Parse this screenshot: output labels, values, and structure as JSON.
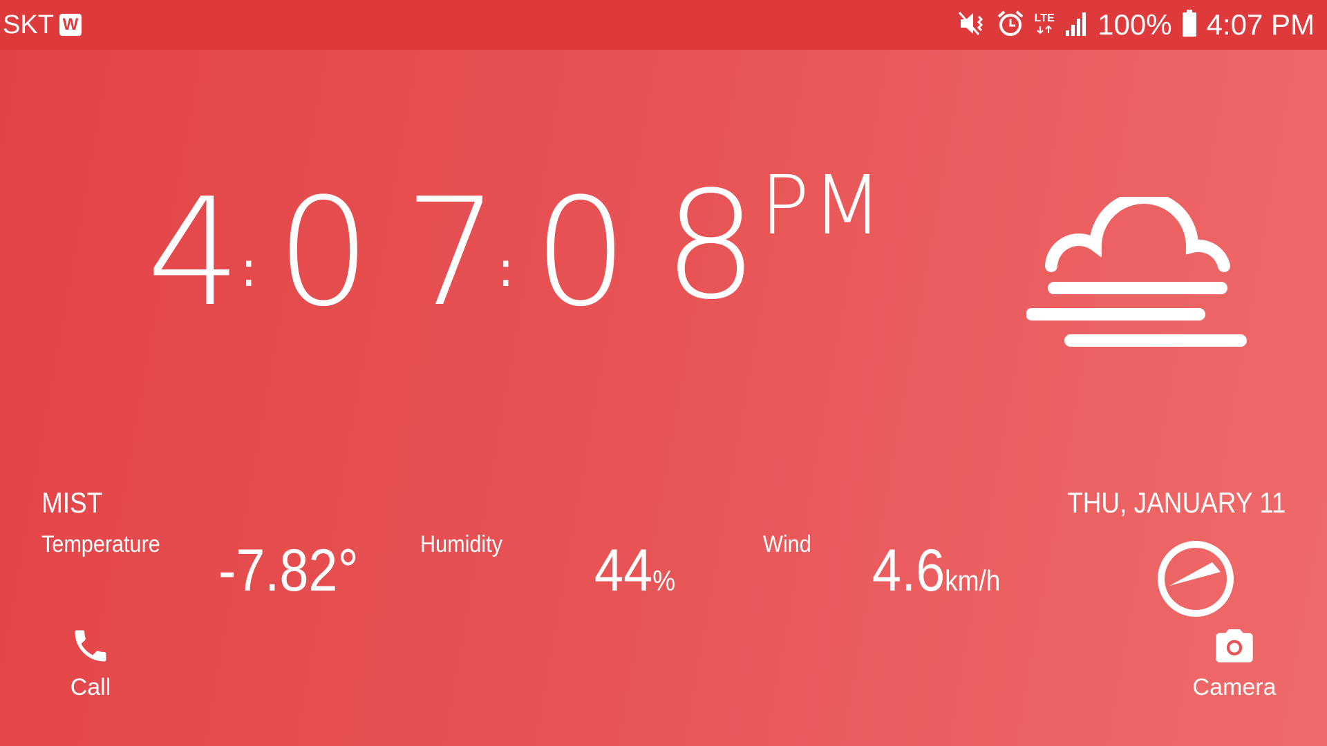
{
  "status_bar": {
    "carrier": "SKT",
    "badge": "W",
    "network": "LTE",
    "battery": "100%",
    "time": "4:07 PM",
    "icons": [
      "vibrate-mute-icon",
      "alarm-icon",
      "lte-icon",
      "signal-icon",
      "battery-icon"
    ]
  },
  "clock": {
    "h": "4",
    "m1": "0",
    "m2": "7",
    "s1": "0",
    "s2": "8",
    "colon": ":",
    "ampm": "PM"
  },
  "weather": {
    "condition": "MIST",
    "icon": "mist-icon",
    "temperature_label": "Temperature",
    "temperature_value": "-7.82°",
    "humidity_label": "Humidity",
    "humidity_value": "44",
    "humidity_unit": "%",
    "wind_label": "Wind",
    "wind_value": "4.6",
    "wind_unit": "km/h",
    "wind_direction_icon": "wind-compass-icon"
  },
  "date": "THU, JANUARY 11",
  "shortcuts": {
    "call_label": "Call",
    "camera_label": "Camera"
  },
  "colors": {
    "status_bar": "#de3a3c",
    "background_start": "#e24446",
    "background_end": "#ef6a6a",
    "foreground": "#ffffff"
  }
}
